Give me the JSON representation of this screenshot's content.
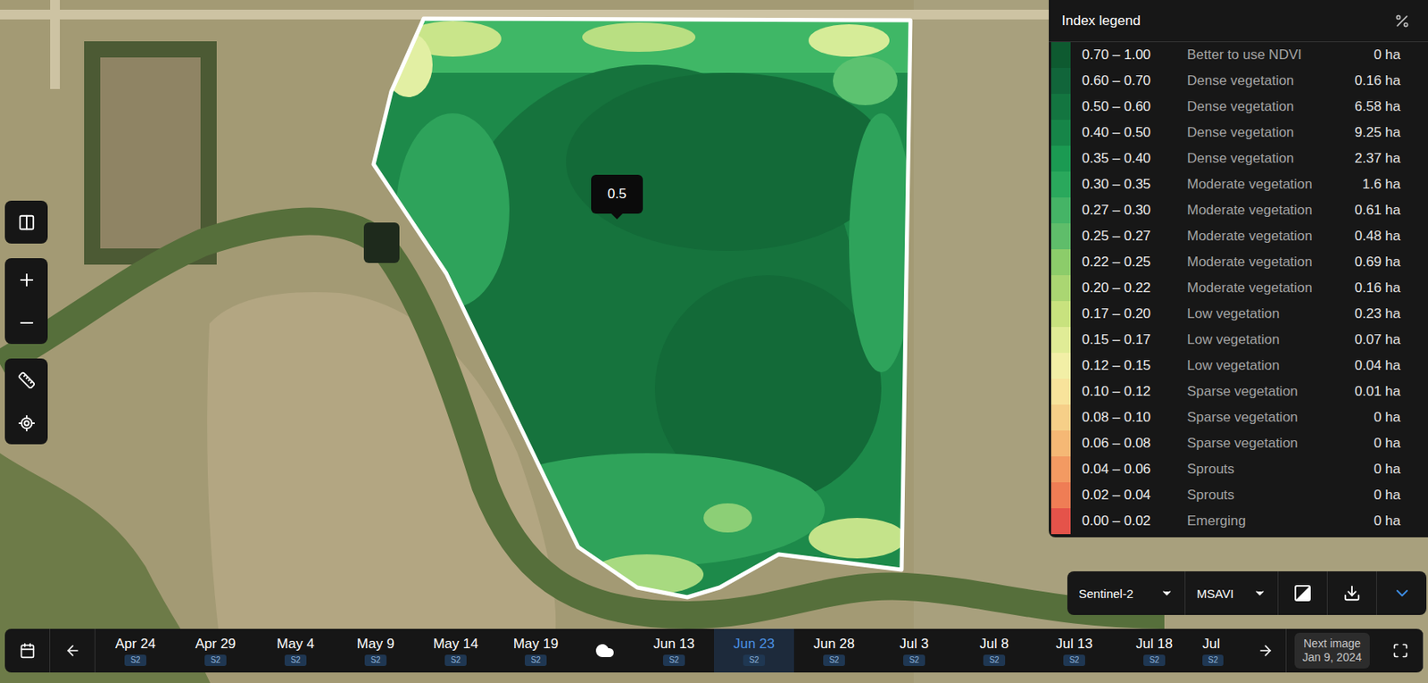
{
  "map": {
    "tooltip": "0.5"
  },
  "legend": {
    "title": "Index legend",
    "rows": [
      {
        "range": "0.70 – 1.00",
        "label": "Better to use NDVI",
        "area": "0 ha",
        "color": "#0e5a30"
      },
      {
        "range": "0.60 – 0.70",
        "label": "Dense vegetation",
        "area": "0.16 ha",
        "color": "#11653a"
      },
      {
        "range": "0.50 – 0.60",
        "label": "Dense vegetation",
        "area": "6.58 ha",
        "color": "#137540"
      },
      {
        "range": "0.40 – 0.50",
        "label": "Dense vegetation",
        "area": "9.25 ha",
        "color": "#168548"
      },
      {
        "range": "0.35 – 0.40",
        "label": "Dense vegetation",
        "area": "2.37 ha",
        "color": "#1b9a52"
      },
      {
        "range": "0.30 – 0.35",
        "label": "Moderate vegetation",
        "area": "1.6 ha",
        "color": "#2aa85c"
      },
      {
        "range": "0.27 – 0.30",
        "label": "Moderate vegetation",
        "area": "0.61 ha",
        "color": "#45b466"
      },
      {
        "range": "0.25 – 0.27",
        "label": "Moderate vegetation",
        "area": "0.48 ha",
        "color": "#5fbd6a"
      },
      {
        "range": "0.22 – 0.25",
        "label": "Moderate vegetation",
        "area": "0.69 ha",
        "color": "#8ccc6a"
      },
      {
        "range": "0.20 – 0.22",
        "label": "Moderate vegetation",
        "area": "0.16 ha",
        "color": "#aad672"
      },
      {
        "range": "0.17 – 0.20",
        "label": "Low vegetation",
        "area": "0.23 ha",
        "color": "#c8e27e"
      },
      {
        "range": "0.15 – 0.17",
        "label": "Low vegetation",
        "area": "0.07 ha",
        "color": "#e0ec96"
      },
      {
        "range": "0.12 – 0.15",
        "label": "Low vegetation",
        "area": "0.04 ha",
        "color": "#f2efa6"
      },
      {
        "range": "0.10 – 0.12",
        "label": "Sparse vegetation",
        "area": "0.01 ha",
        "color": "#f8e39b"
      },
      {
        "range": "0.08 – 0.10",
        "label": "Sparse vegetation",
        "area": "0 ha",
        "color": "#f6cf88"
      },
      {
        "range": "0.06 – 0.08",
        "label": "Sparse vegetation",
        "area": "0 ha",
        "color": "#f5b875"
      },
      {
        "range": "0.04 – 0.06",
        "label": "Sprouts",
        "area": "0 ha",
        "color": "#f39a62"
      },
      {
        "range": "0.02 – 0.04",
        "label": "Sprouts",
        "area": "0 ha",
        "color": "#ef7d55"
      },
      {
        "range": "0.00 – 0.02",
        "label": "Emerging",
        "area": "0 ha",
        "color": "#e5534a"
      }
    ]
  },
  "source_bar": {
    "satellite": "Sentinel-2",
    "index": "MSAVI"
  },
  "timeline": {
    "items": [
      {
        "kind": "date",
        "label": "Apr 24",
        "badge": "S2",
        "selected": false
      },
      {
        "kind": "date",
        "label": "Apr 29",
        "badge": "S2",
        "selected": false
      },
      {
        "kind": "date",
        "label": "May 4",
        "badge": "S2",
        "selected": false
      },
      {
        "kind": "date",
        "label": "May 9",
        "badge": "S2",
        "selected": false
      },
      {
        "kind": "date",
        "label": "May 14",
        "badge": "S2",
        "selected": false
      },
      {
        "kind": "date",
        "label": "May 19",
        "badge": "S2",
        "selected": false
      },
      {
        "kind": "cloud",
        "selected": false
      },
      {
        "kind": "date",
        "label": "Jun 13",
        "badge": "S2",
        "selected": false
      },
      {
        "kind": "date",
        "label": "Jun 23",
        "badge": "S2",
        "selected": true
      },
      {
        "kind": "date",
        "label": "Jun 28",
        "badge": "S2",
        "selected": false
      },
      {
        "kind": "date",
        "label": "Jul 3",
        "badge": "S2",
        "selected": false
      },
      {
        "kind": "date",
        "label": "Jul 8",
        "badge": "S2",
        "selected": false
      },
      {
        "kind": "date",
        "label": "Jul 13",
        "badge": "S2",
        "selected": false
      },
      {
        "kind": "date",
        "label": "Jul 18",
        "badge": "S2",
        "selected": false
      },
      {
        "kind": "date",
        "label": "Jul",
        "badge": "S2",
        "selected": false
      }
    ],
    "next_image": {
      "label": "Next image",
      "date": "Jan 9, 2024"
    }
  }
}
